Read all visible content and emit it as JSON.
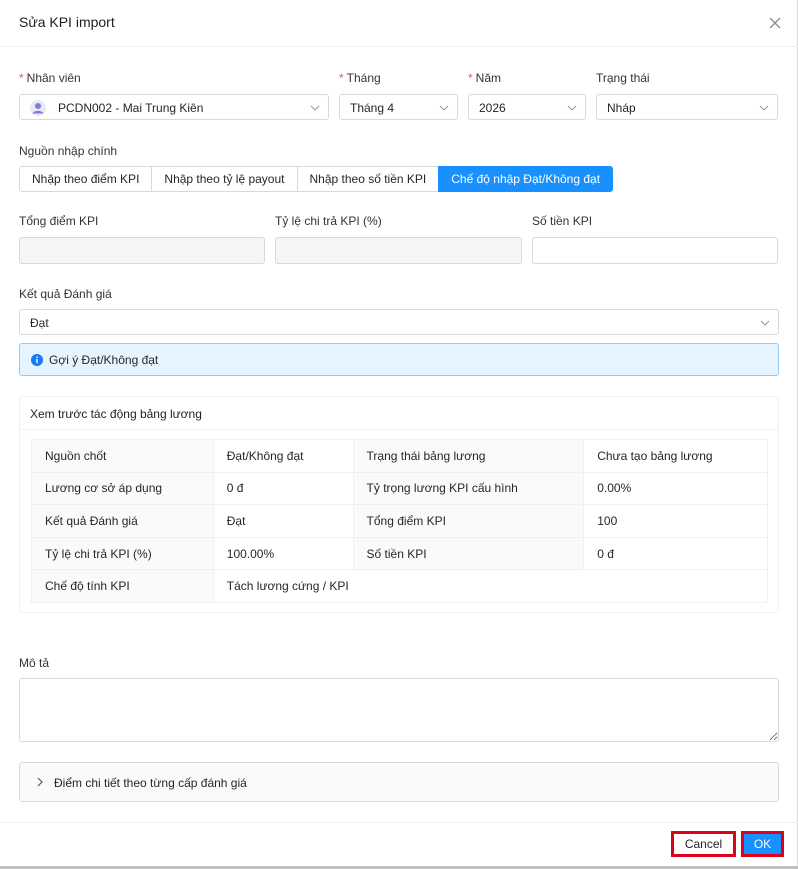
{
  "modal": {
    "title": "Sửa KPI import"
  },
  "fields": {
    "employee": {
      "label": "Nhân viên",
      "value": "PCDN002 - Mai Trung Kiên"
    },
    "month": {
      "label": "Tháng",
      "value": "Tháng 4"
    },
    "year": {
      "label": "Năm",
      "value": "2026"
    },
    "status": {
      "label": "Trạng thái",
      "value": "Nháp"
    },
    "required_mark": "*"
  },
  "source": {
    "label": "Nguồn nhập chính",
    "options": [
      "Nhập theo điểm KPI",
      "Nhập theo tỷ lệ payout",
      "Nhập theo số tiền KPI",
      "Chế độ nhập Đạt/Không đạt"
    ],
    "selected_index": 3
  },
  "kpi_inputs": {
    "total_score_label": "Tổng điểm KPI",
    "payout_rate_label": "Tỷ lệ chi trả KPI (%)",
    "amount_label": "Số tiền KPI"
  },
  "evaluation": {
    "label": "Kết quả Đánh giá",
    "value": "Đạt"
  },
  "hint": {
    "text": "Gợi ý Đạt/Không đạt"
  },
  "preview": {
    "title": "Xem trước tác động bảng lương",
    "rows": [
      [
        "Nguồn chốt",
        "Đạt/Không đạt",
        "Trạng thái bảng lương",
        "Chưa tạo bảng lương"
      ],
      [
        "Lương cơ sở áp dụng",
        "0 đ",
        "Tỷ trọng lương KPI cấu hình",
        "0.00%"
      ],
      [
        "Kết quả Đánh giá",
        "Đạt",
        "Tổng điểm KPI",
        "100"
      ],
      [
        "Tỷ lệ chi trả KPI (%)",
        "100.00%",
        "Số tiền KPI",
        "0 đ"
      ],
      [
        "Chế độ tính KPI",
        "Tách lương cứng / KPI"
      ]
    ]
  },
  "description": {
    "label": "Mô tả"
  },
  "details": {
    "label": "Điểm chi tiết theo từng cấp đánh giá"
  },
  "footer": {
    "cancel": "Cancel",
    "ok": "OK"
  }
}
